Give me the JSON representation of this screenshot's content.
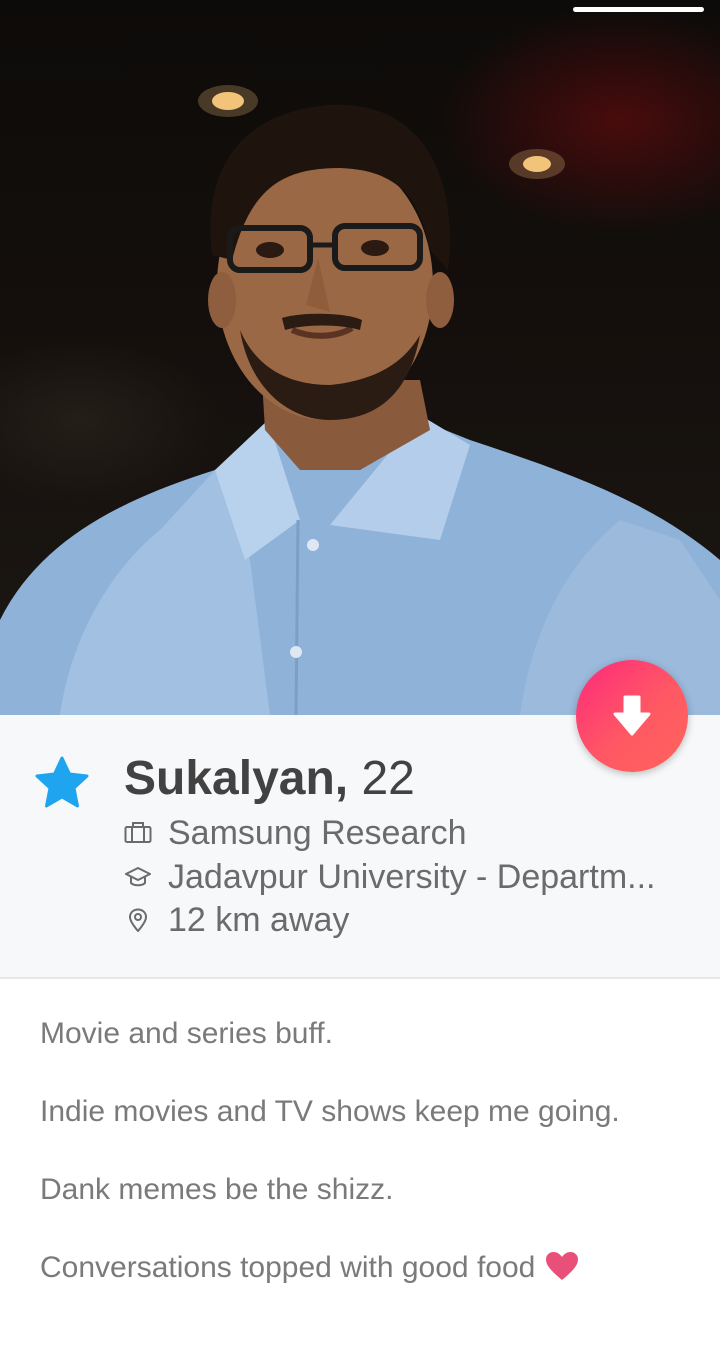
{
  "profile": {
    "name": "Sukalyan,",
    "age": "22",
    "job": "Samsung Research",
    "school": "Jadavpur University - Departm...",
    "distance": "12 km away"
  },
  "bio": {
    "lines": [
      "Movie and series buff.",
      "Indie movies and TV shows keep me going.",
      "Dank memes be the shizz.",
      "Conversations topped with good food"
    ]
  },
  "icons": {
    "star": "star-icon",
    "briefcase": "briefcase-icon",
    "graduation": "graduation-cap-icon",
    "location": "location-pin-icon",
    "collapse": "arrow-down-icon",
    "heart": "heart-icon"
  },
  "colors": {
    "star": "#1fa4f0",
    "button_gradient_start": "#fd297b",
    "button_gradient_end": "#ff655b",
    "heart": "#e8507a"
  }
}
